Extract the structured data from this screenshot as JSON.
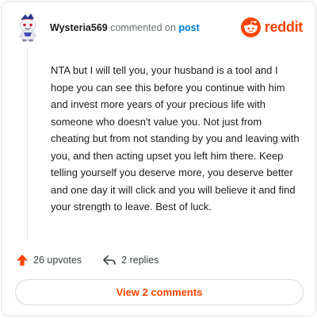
{
  "comment": {
    "username": "Wysteria569",
    "action_text": "commented on",
    "target_link": "post",
    "body": "NTA but I will tell you, your husband is a tool and I hope you can see this before you continue with him and invest more years of your precious life with someone who doesn't value you. Not just from cheating but from not standing by you and leaving with you, and then acting upset you left him there. Keep telling yourself you deserve more, you deserve better and one day it will click and you will believe it and find your strength to leave. Best of luck.",
    "upvotes_label": "26 upvotes",
    "replies_label": "2 replies"
  },
  "brand": {
    "wordmark": "reddit",
    "color": "#ff4500"
  },
  "footer": {
    "view_comments_label": "View 2 comments"
  },
  "icons": {
    "avatar": "snoo-avatar-icon",
    "brand": "reddit-logo-icon",
    "upvote": "upvote-arrow-icon",
    "reply": "reply-arrow-icon"
  },
  "colors": {
    "accent": "#ff4500",
    "link": "#0079d3",
    "muted": "#6b6f72"
  }
}
